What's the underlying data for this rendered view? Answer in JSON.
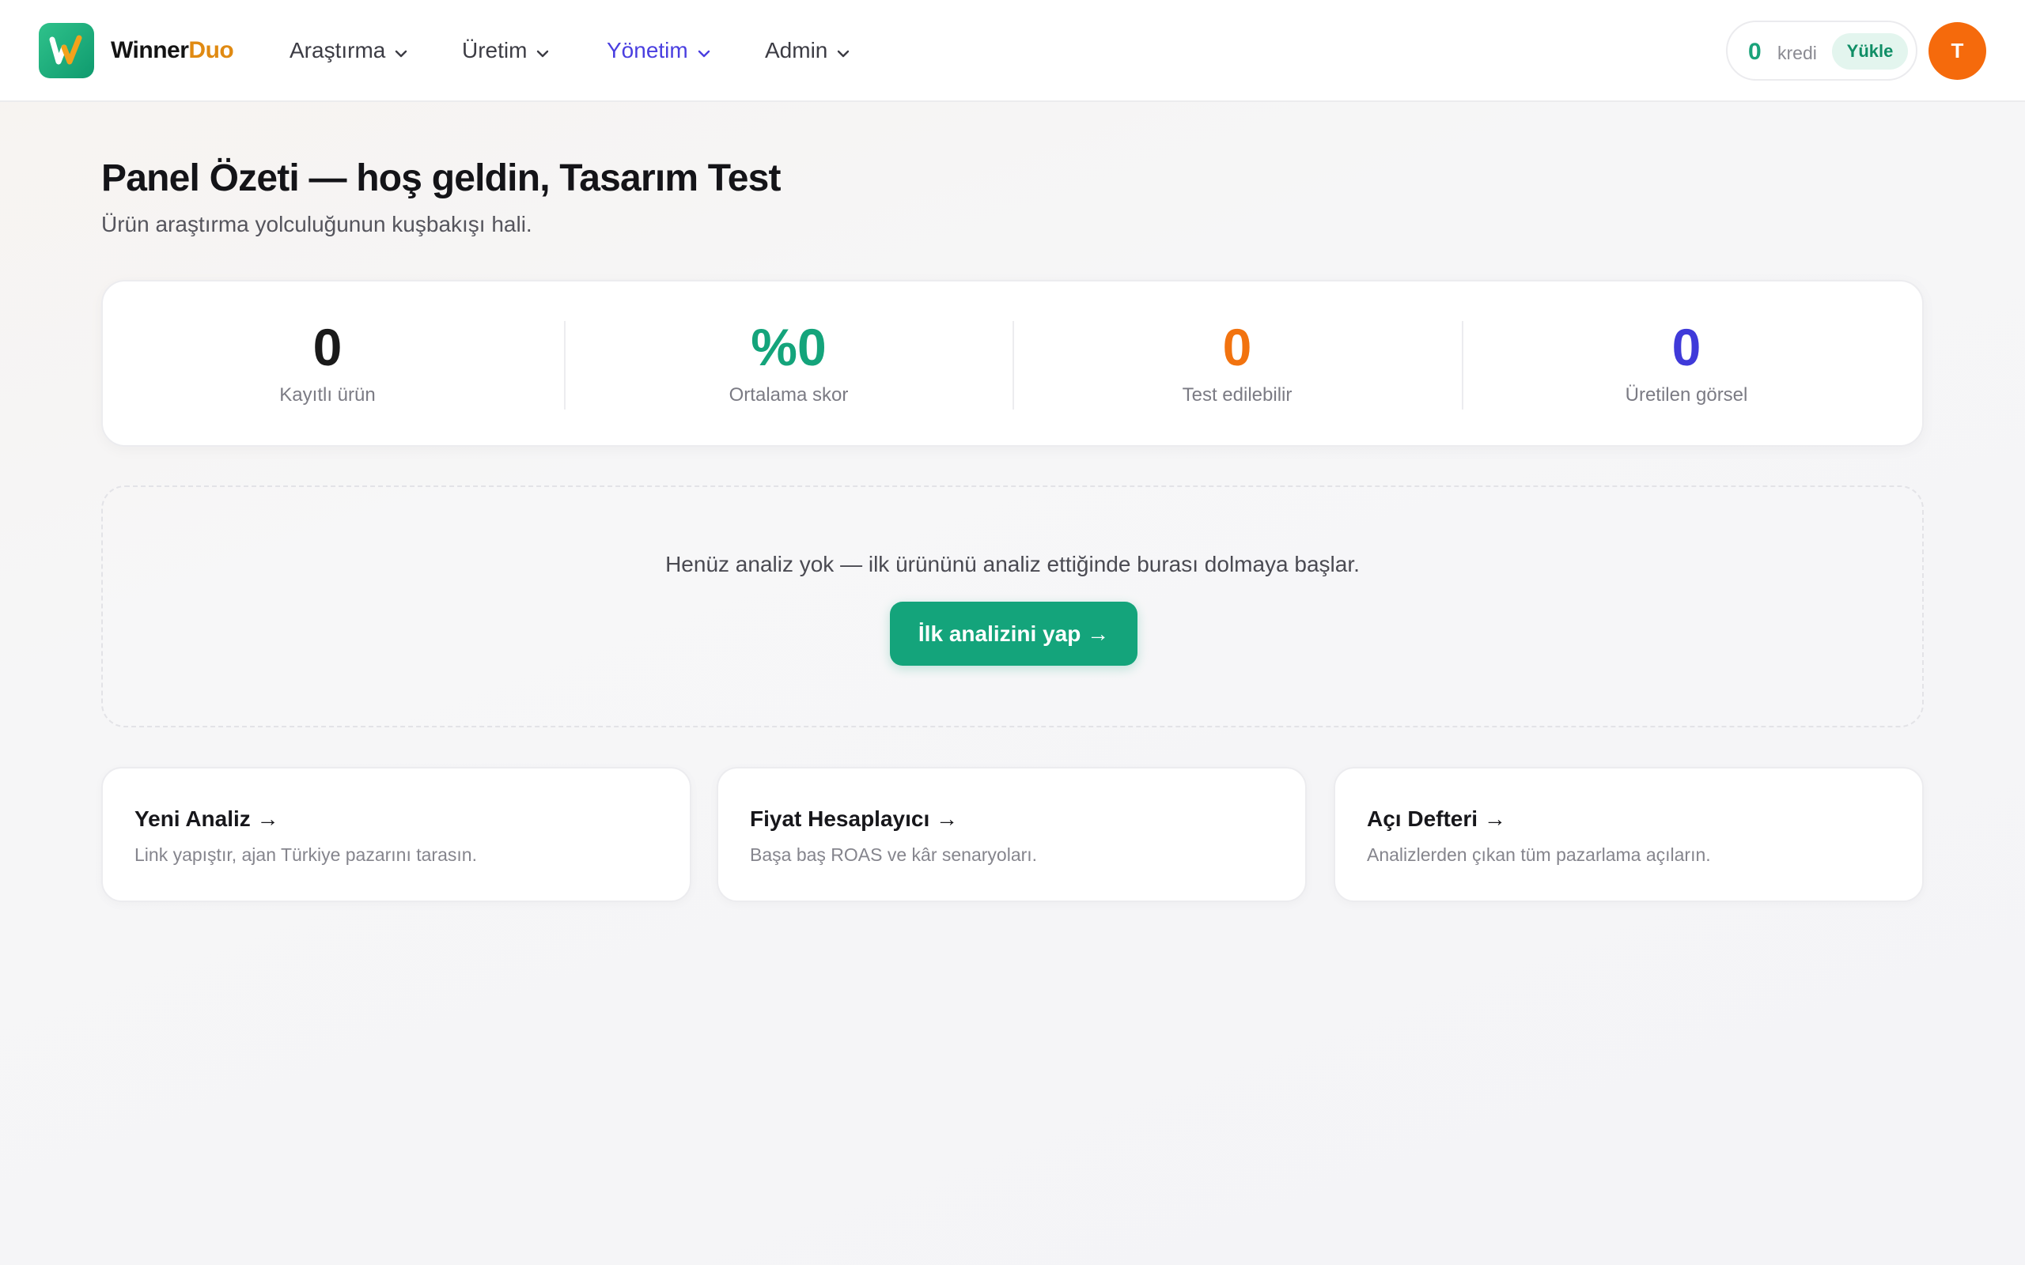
{
  "header": {
    "brand_part1": "Winner",
    "brand_part2": "Duo",
    "nav": [
      {
        "label": "Araştırma",
        "active": false
      },
      {
        "label": "Üretim",
        "active": false
      },
      {
        "label": "Yönetim",
        "active": true
      },
      {
        "label": "Admin",
        "active": false
      }
    ],
    "credit": {
      "value": "0",
      "label": "kredi",
      "load_label": "Yükle"
    },
    "avatar_initial": "T"
  },
  "main": {
    "title": "Panel Özeti — hoş geldin, Tasarım Test",
    "subtitle": "Ürün araştırma yolculuğunun kuşbakışı hali.",
    "stats": [
      {
        "value": "0",
        "label": "Kayıtlı ürün",
        "color": "#1a1a1a"
      },
      {
        "value": "%0",
        "label": "Ortalama skor",
        "color": "#14a47b"
      },
      {
        "value": "0",
        "label": "Test edilebilir",
        "color": "#f2730f"
      },
      {
        "value": "0",
        "label": "Üretilen görsel",
        "color": "#3f3ad9"
      }
    ],
    "empty_state": {
      "text": "Henüz analiz yok — ilk ürününü analiz ettiğinde burası dolmaya başlar.",
      "cta_label": "İlk analizini yap →"
    },
    "quick_links": [
      {
        "title": "Yeni Analiz →",
        "desc": "Link yapıştır, ajan Türkiye pazarını tarasın."
      },
      {
        "title": "Fiyat Hesaplayıcı →",
        "desc": "Başa baş ROAS ve kâr senaryoları."
      },
      {
        "title": "Açı Defteri →",
        "desc": "Analizlerden çıkan tüm pazarlama açıların."
      }
    ]
  },
  "colors": {
    "accent_green": "#14a47b",
    "brand_orange": "#e08a12",
    "active_nav": "#4a3fe0",
    "avatar": "#f56a0c"
  },
  "icons": [
    "logo-w-icon",
    "chevron-down-icon"
  ]
}
